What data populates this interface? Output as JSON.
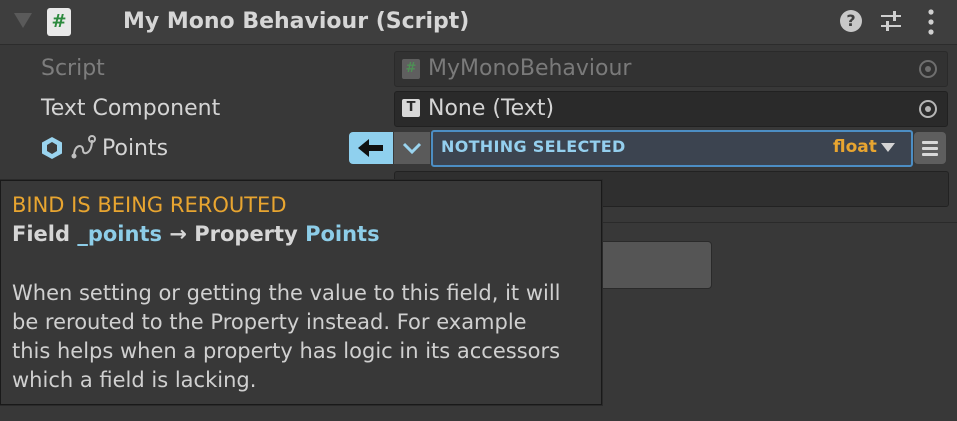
{
  "header": {
    "title": "My Mono Behaviour (Script)",
    "script_icon_glyph": "#",
    "help_glyph": "?"
  },
  "rows": {
    "script": {
      "label": "Script",
      "value": "MyMonoBehaviour",
      "icon_glyph": "#"
    },
    "text_component": {
      "label": "Text Component",
      "value": "None (Text)",
      "icon_glyph": "T"
    },
    "points": {
      "label": "Points",
      "bind_value": "NOTHING SELECTED",
      "type": "float"
    }
  },
  "tooltip": {
    "title": "BIND IS BEING REROUTED",
    "subtitle_prefix": "Field",
    "field_name": "_points",
    "arrow": "→",
    "subtitle_mid": "Property",
    "property_name": "Points",
    "body_lines": [
      "When setting or getting the value to this field, it will",
      "be rerouted to the Property instead. For example",
      "this helps when a property has logic in its accessors",
      "which a field is lacking."
    ]
  },
  "colors": {
    "accent_blue": "#8fd0ee",
    "focus_border": "#4c8ec4",
    "warning_orange": "#e8a530",
    "background": "#383838"
  },
  "icons": [
    "foldout-triangle-icon",
    "script-icon",
    "help-icon",
    "presets-icon",
    "menu-icon",
    "object-picker-icon",
    "hexagon-icon",
    "path-icon",
    "arrow-left-icon",
    "chevron-down-icon",
    "list-icon"
  ]
}
